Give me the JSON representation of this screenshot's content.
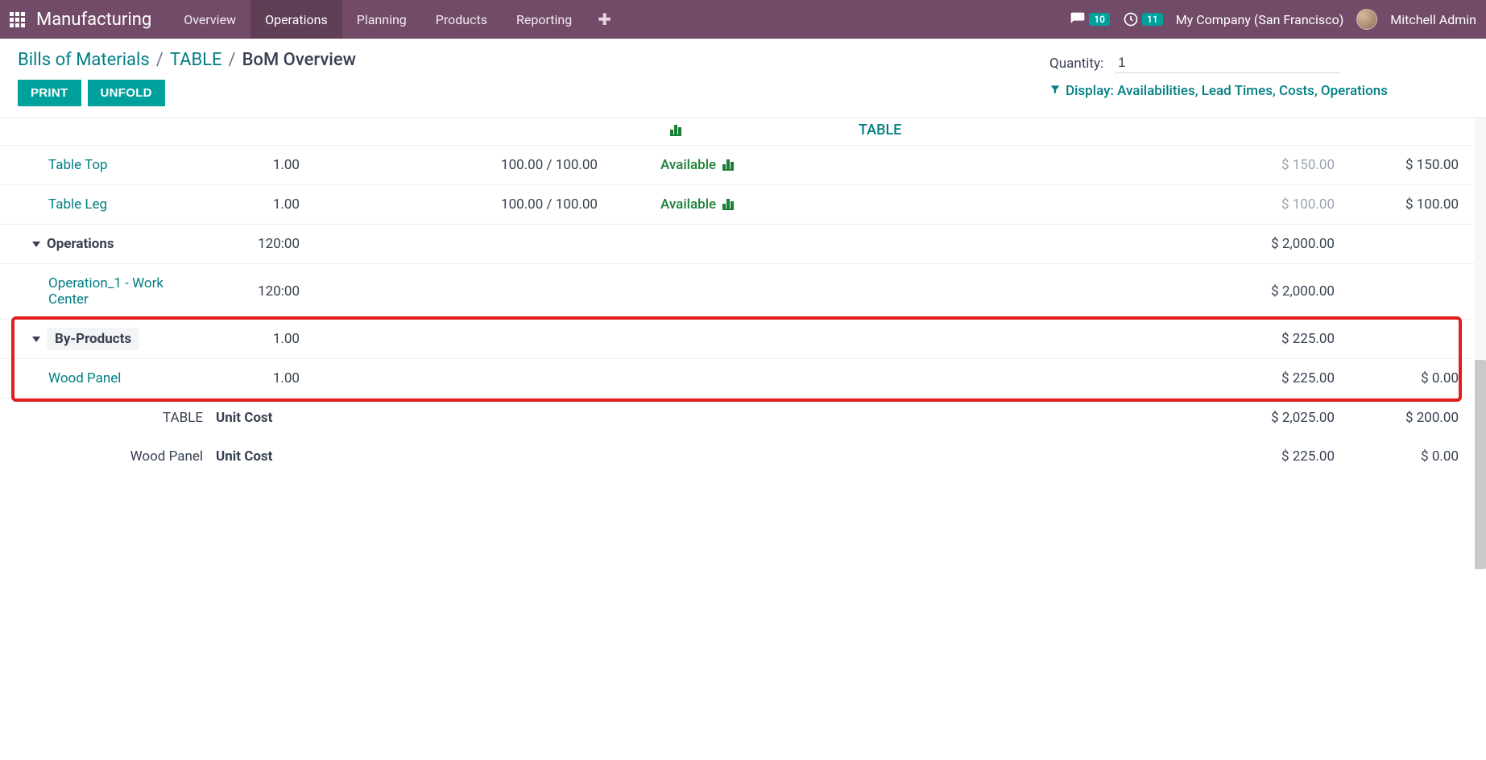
{
  "navbar": {
    "brand": "Manufacturing",
    "menu": [
      "Overview",
      "Operations",
      "Planning",
      "Products",
      "Reporting"
    ],
    "active_index": 1,
    "messages_badge": "10",
    "activities_badge": "11",
    "company": "My Company (San Francisco)",
    "user": "Mitchell Admin"
  },
  "breadcrumb": {
    "items": [
      "Bills of Materials",
      "TABLE"
    ],
    "current": "BoM Overview"
  },
  "buttons": {
    "print": "PRINT",
    "unfold": "UNFOLD"
  },
  "quantity": {
    "label": "Quantity:",
    "value": "1"
  },
  "display_filter": "Display: Availabilities, Lead Times, Costs, Operations",
  "product_header": "TABLE",
  "rows": {
    "table_top": {
      "name": "Table Top",
      "qty": "1.00",
      "free": "100.00 / 100.00",
      "avail": "Available",
      "bom_cost": "$ 150.00",
      "prod_cost": "$ 150.00"
    },
    "table_leg": {
      "name": "Table Leg",
      "qty": "1.00",
      "free": "100.00 / 100.00",
      "avail": "Available",
      "bom_cost": "$ 100.00",
      "prod_cost": "$ 100.00"
    },
    "operations": {
      "label": "Operations",
      "duration": "120:00",
      "cost": "$ 2,000.00"
    },
    "operation_1": {
      "name": "Operation_1 - Work Center",
      "duration": "120:00",
      "cost": "$ 2,000.00"
    },
    "byproducts": {
      "label": "By-Products",
      "qty": "1.00",
      "cost": "$ 225.00"
    },
    "wood_panel": {
      "name": "Wood Panel",
      "qty": "1.00",
      "bom_cost": "$ 225.00",
      "prod_cost": "$ 0.00"
    }
  },
  "summary": {
    "unit_cost_label": "Unit Cost",
    "table": {
      "name": "TABLE",
      "bom_cost": "$ 2,025.00",
      "prod_cost": "$ 200.00"
    },
    "wood": {
      "name": "Wood Panel",
      "bom_cost": "$ 225.00",
      "prod_cost": "$ 0.00"
    }
  }
}
